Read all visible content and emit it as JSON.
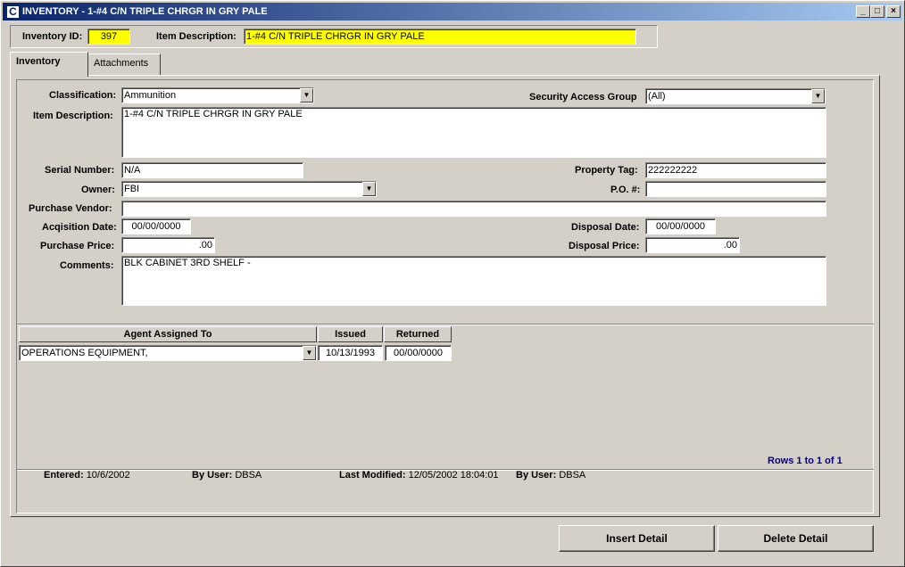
{
  "window": {
    "title": "INVENTORY - 1-#4 C/N TRIPLE CHRGR IN GRY PALE",
    "icon": "app-icon",
    "app_icon_letter": "C",
    "minimize_glyph": "_",
    "maximize_glyph": "□",
    "close_glyph": "×"
  },
  "header": {
    "inventory_id_label": "Inventory ID:",
    "inventory_id": "397",
    "item_description_label": "Item Description:",
    "item_description": "1-#4 C/N TRIPLE CHRGR IN GRY PALE",
    "highlight_color": "#ffff00"
  },
  "tabs": [
    {
      "label": "Inventory",
      "active": true
    },
    {
      "label": "Attachments",
      "active": false
    }
  ],
  "form": {
    "classification_label": "Classification:",
    "classification": "Ammunition",
    "security_group_label": "Security Access Group",
    "security_group": "(All)",
    "item_description_label": "Item Description:",
    "item_description": "1-#4 C/N TRIPLE CHRGR IN GRY PALE",
    "serial_number_label": "Serial Number:",
    "serial_number": "N/A",
    "property_tag_label": "Property Tag:",
    "property_tag": "222222222",
    "owner_label": "Owner:",
    "owner": "FBI",
    "po_label": "P.O. #:",
    "po": "",
    "purchase_vendor_label": "Purchase Vendor:",
    "purchase_vendor": "",
    "acquisition_date_label": "Acqisition Date:",
    "acquisition_date": "00/00/0000",
    "disposal_date_label": "Disposal Date:",
    "disposal_date": "00/00/0000",
    "purchase_price_label": "Purchase Price:",
    "purchase_price": ".00",
    "disposal_price_label": "Disposal Price:",
    "disposal_price": ".00",
    "comments_label": "Comments:",
    "comments": "BLK CABINET 3RD SHELF -"
  },
  "grid": {
    "columns": [
      "Agent Assigned To",
      "Issued",
      "Returned"
    ],
    "rows": [
      {
        "agent": "OPERATIONS EQUIPMENT,",
        "issued": "10/13/1993",
        "returned": "00/00/0000"
      }
    ],
    "rows_status": "Rows 1 to 1 of 1",
    "rows_status_color": "#000080"
  },
  "footer": {
    "entered_label": "Entered:",
    "entered": "10/6/2002",
    "by_user_label": "By User:",
    "by_user": "DBSA",
    "last_modified_label": "Last Modified:",
    "last_modified": "12/05/2002 18:04:01",
    "by_user2_label": "By User:",
    "by_user2": "DBSA"
  },
  "buttons": {
    "insert_detail": "Insert Detail",
    "delete_detail": "Delete Detail"
  },
  "dropdown_glyph": "▼"
}
